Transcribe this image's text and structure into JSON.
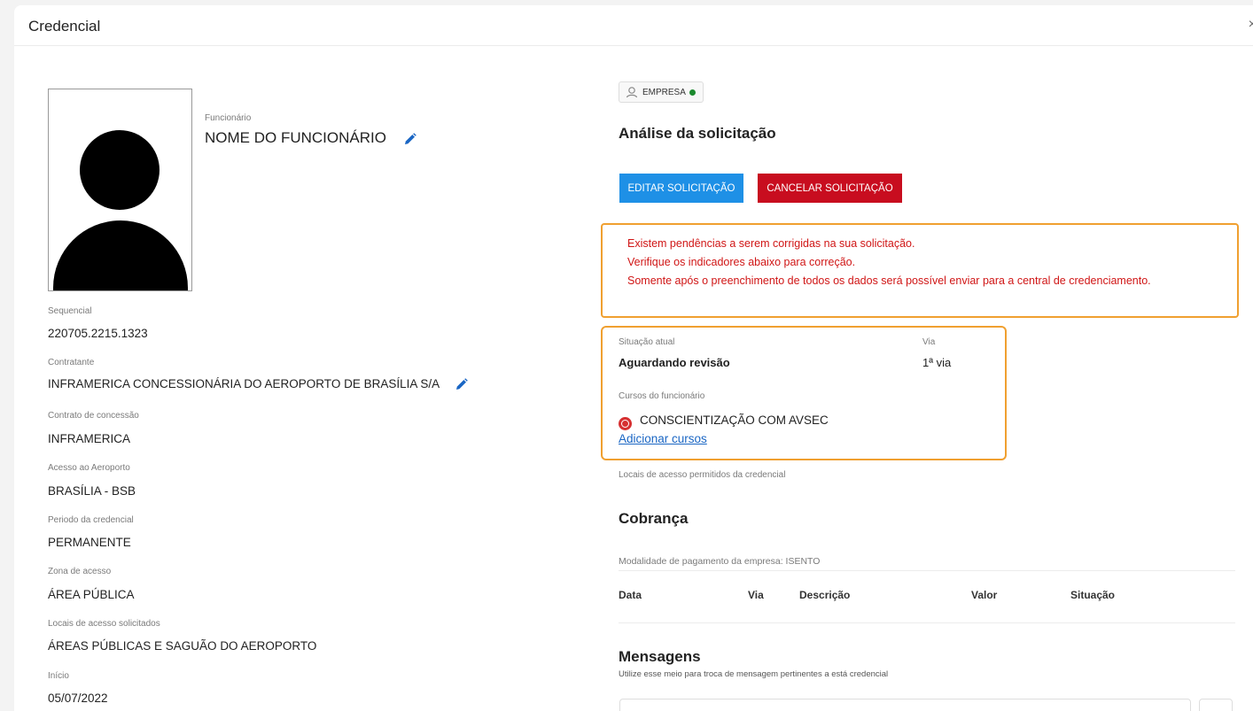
{
  "window": {
    "title": "Credencial",
    "close_glyph": "×"
  },
  "employee": {
    "label": "Funcionário",
    "name": "NOME DO FUNCIONÁRIO"
  },
  "details": {
    "sequencial_label": "Sequencial",
    "sequencial_value": "220705.2215.1323",
    "contratante_label": "Contratante",
    "contratante_value": "INFRAMERICA CONCESSIONÁRIA DO AEROPORTO DE BRASÍLIA S/A",
    "contrato_label": "Contrato de concessão",
    "contrato_value": "INFRAMERICA",
    "acesso_label": "Acesso ao Aeroporto",
    "acesso_value": "BRASÍLIA - BSB",
    "periodo_label": "Periodo da credencial",
    "periodo_value": "PERMANENTE",
    "zona_label": "Zona de acesso",
    "zona_value": "ÁREA PÚBLICA",
    "locais_label": "Locais de acesso solicitados",
    "locais_value": "ÁREAS PÚBLICAS E SAGUÃO DO AEROPORTO",
    "inicio_label": "Início",
    "inicio_value": "05/07/2022"
  },
  "badge": {
    "label": "EMPRESA"
  },
  "analysis": {
    "title": "Análise da solicitação",
    "edit_button": "EDITAR SOLICITAÇÃO",
    "cancel_button": "CANCELAR SOLICITAÇÃO",
    "alert_line1": "Existem pendências a serem corrigidas na sua solicitação.",
    "alert_line2": "Verifique os indicadores abaixo para correção.",
    "alert_line3": "Somente após o preenchimento de todos os dados será possível enviar para a central de credenciamento."
  },
  "status": {
    "situacao_label": "Situação atual",
    "situacao_value": "Aguardando revisão",
    "via_label": "Via",
    "via_value": "1ª via",
    "cursos_label": "Cursos do funcionário",
    "course_name": "CONSCIENTIZAÇÃO COM AVSEC",
    "add_courses_link": "Adicionar cursos"
  },
  "locais_permitidos": "Locais de acesso permitidos da credencial",
  "cobranca": {
    "title": "Cobrança",
    "modalidade": "Modalidade de pagamento da empresa: ISENTO",
    "columns": [
      "Data",
      "Via",
      "Descrição",
      "Valor",
      "Situação"
    ]
  },
  "mensagens": {
    "title": "Mensagens",
    "subtitle": "Utilize esse meio para troca de mensagem pertinentes a está credencial"
  },
  "colors": {
    "edit_button": "#1e90e6",
    "cancel_button": "#c80d1f",
    "alert_text": "#d01616",
    "alert_border": "#f0a030",
    "status_dot": "#1b8a2e",
    "link": "#1a66c4"
  },
  "icons": {
    "close": "close-icon",
    "pencil": "pencil-icon",
    "avatar": "avatar-icon",
    "course_error": "error-circle-icon"
  }
}
